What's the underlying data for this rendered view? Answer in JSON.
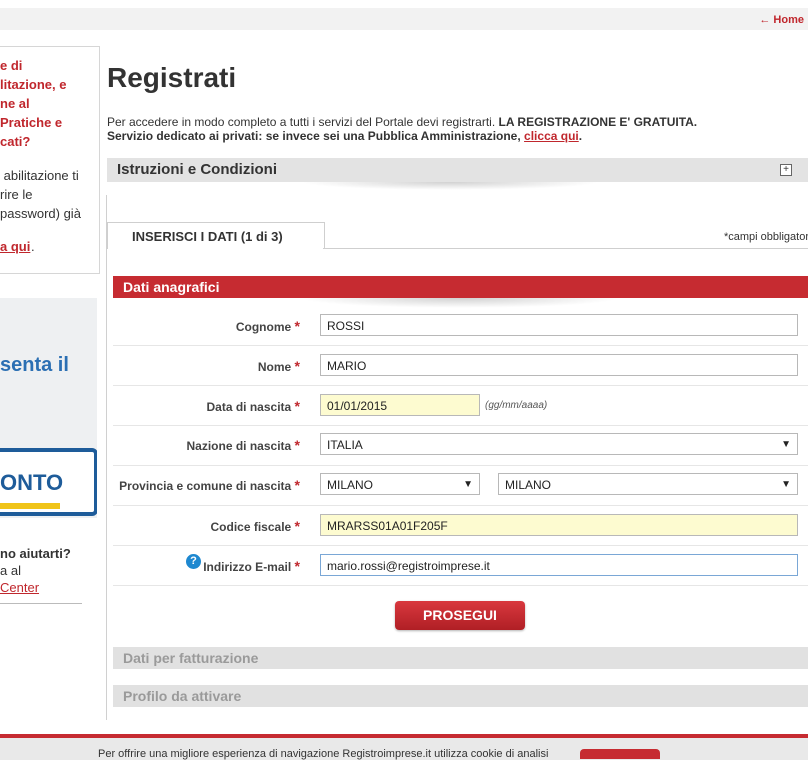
{
  "header": {
    "home_label": "← Home"
  },
  "sidebar": {
    "promo_red": "e di\nlitazione, e\nne al\nPratiche e\ncati?",
    "promo_text": " abilitazione ti\nrire le\npassword) già",
    "promo_link": "a qui",
    "promo_dot": ".",
    "banner_text": "senta il",
    "banner_word": "ONTO",
    "help_title": "no aiutarti?",
    "help_line": "a al",
    "help_link": "Center"
  },
  "page": {
    "title": "Registrati",
    "intro_line1": "Per accedere in modo completo a tutti i servizi del Portale devi registrarti.",
    "intro_line1_bold": "LA REGISTRAZIONE E' GRATUITA.",
    "intro_line2": "Servizio dedicato ai privati: se invece sei una Pubblica Amministrazione,",
    "intro_link": "clicca qui",
    "intro_end": "."
  },
  "istruzioni": {
    "label": "Istruzioni e Condizioni",
    "toggle": "+"
  },
  "tab": {
    "label": "INSERISCI I DATI (1 di 3)",
    "required_note": "*campi obbligatori"
  },
  "section": {
    "title": "Dati anagrafici"
  },
  "form": {
    "required_mark": "*",
    "cognome": {
      "label": "Cognome",
      "value": "ROSSI"
    },
    "nome": {
      "label": "Nome",
      "value": "MARIO"
    },
    "data_nascita": {
      "label": "Data di nascita",
      "value": "01/01/2015",
      "hint": "(gg/mm/aaaa)"
    },
    "nazione": {
      "label": "Nazione di nascita",
      "value": "ITALIA"
    },
    "provincia": {
      "label": "Provincia e comune di nascita",
      "provincia_value": "MILANO",
      "comune_value": "MILANO"
    },
    "codice_fiscale": {
      "label": "Codice fiscale",
      "value": "MRARSS01A01F205F"
    },
    "email": {
      "label": "Indirizzo E-mail",
      "value": "mario.rossi@registroimprese.it",
      "help_icon": "question-icon"
    },
    "submit_label": "PROSEGUI",
    "arrow": "▼"
  },
  "collapsed_sections": [
    {
      "label": "Dati per fatturazione"
    },
    {
      "label": "Profilo da attivare"
    }
  ],
  "cookie_bar": {
    "text": "Per offrire una migliore esperienza di navigazione Registroimprese.it utilizza cookie di analisi"
  },
  "colors": {
    "brand_red": "#c62b31",
    "highlight_yellow": "#fdfbd0"
  }
}
